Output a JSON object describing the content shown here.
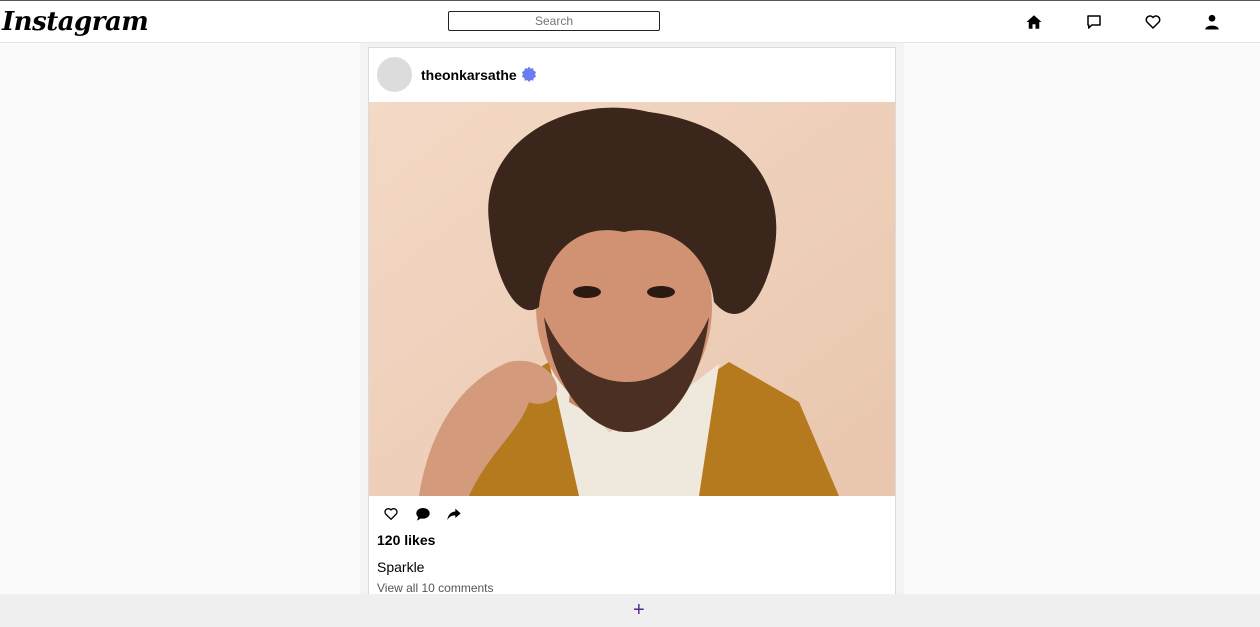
{
  "header": {
    "logo": "Instagram",
    "search_placeholder": "Search",
    "icons": [
      "home-icon",
      "message-icon",
      "heart-icon",
      "profile-icon"
    ]
  },
  "post": {
    "username": "theonkarsathe",
    "verified": true,
    "image_description_icon": "post-photo",
    "likes": "120 likes",
    "caption": "Sparkle",
    "comments_link": "View all 10 comments",
    "actions": [
      "like-icon",
      "comment-icon",
      "share-icon"
    ]
  },
  "footer": {
    "add_label": "+"
  },
  "colors": {
    "verified": "#6b7bf0",
    "add": "#5b2a86"
  }
}
